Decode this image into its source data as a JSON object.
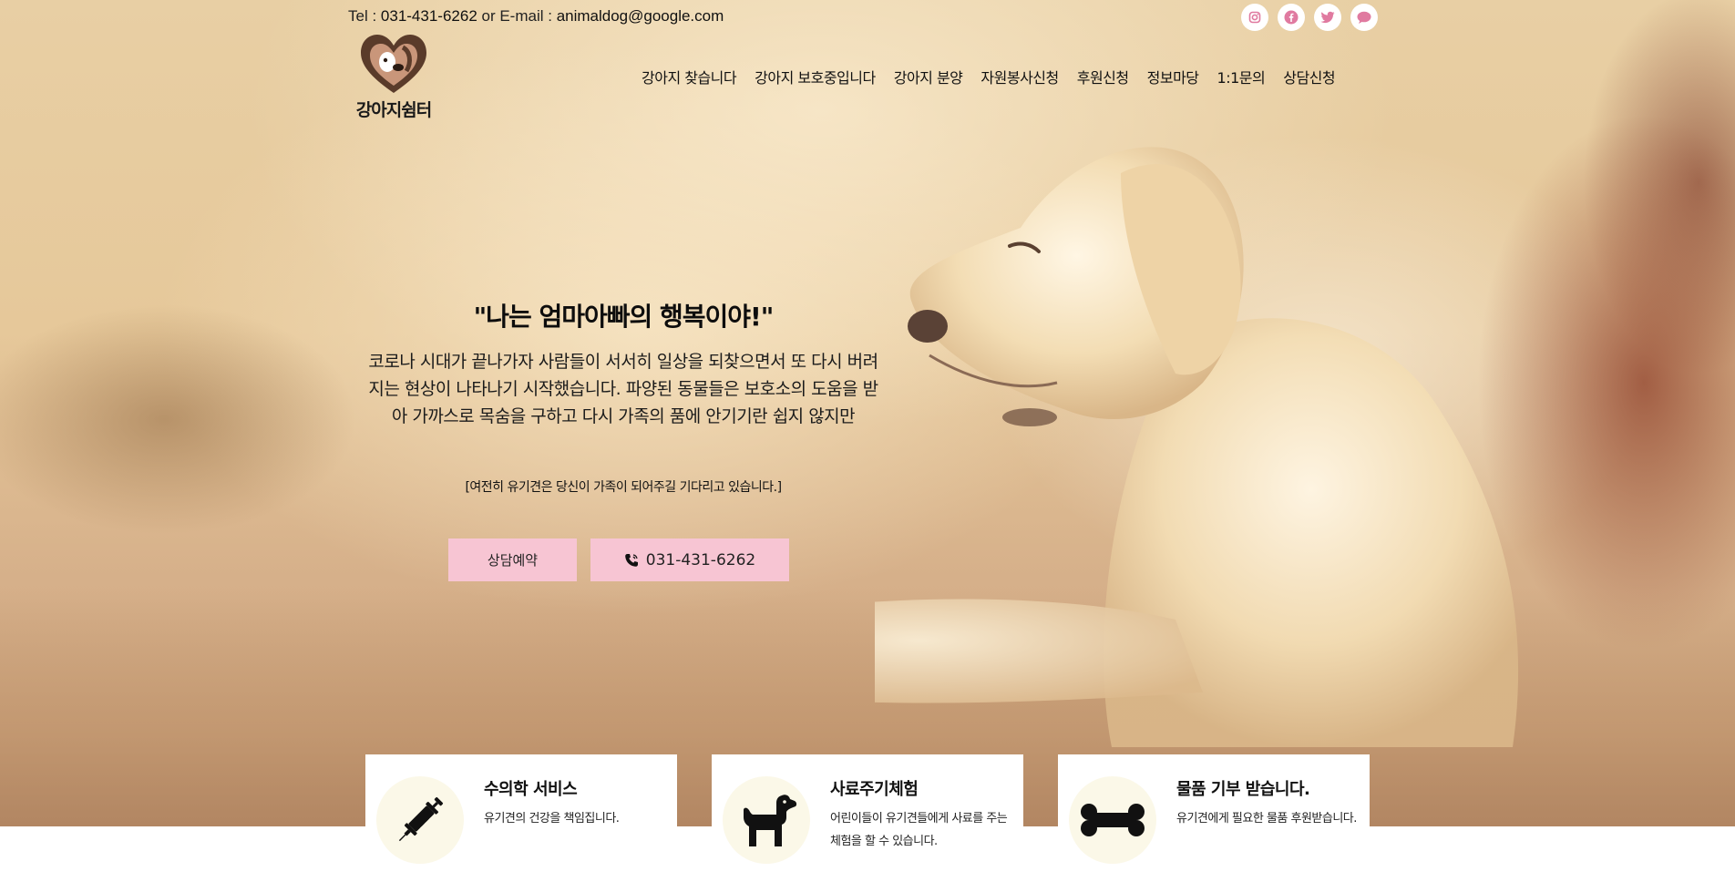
{
  "contact": {
    "tel_label": "Tel : ",
    "tel": "031-431-6262",
    "or_email_label": " or E-mail : ",
    "email": "animaldog@google.com"
  },
  "social": {
    "icons": [
      "instagram-icon",
      "facebook-icon",
      "twitter-icon",
      "chat-icon"
    ]
  },
  "logo": {
    "name": "강아지쉼터"
  },
  "nav": {
    "items": [
      "강아지 찾습니다",
      "강아지 보호중입니다",
      "강아지 분양",
      "자원봉사신청",
      "후원신청",
      "정보마당",
      "1:1문의",
      "상담신청"
    ]
  },
  "hero": {
    "headline": "\"나는 엄마아빠의 행복이야!\"",
    "description": "코로나 시대가 끝나가자 사람들이 서서히 일상을 되찾으면서 또 다시 버려지는 현상이 나타나기 시작했습니다. 파양된 동물들은 보호소의 도움을 받아 가까스로 목숨을 구하고 다시 가족의 품에 안기기란 쉽지 않지만",
    "subtext": "[여전히 유기견은 당신이 가족이 되어주길 기다리고 있습니다.]",
    "reserve_button": "상담예약",
    "phone_button": "031-431-6262"
  },
  "services": [
    {
      "icon": "syringe-icon",
      "title": "수의학 서비스",
      "text": "유기견의 건강을 책임집니다."
    },
    {
      "icon": "dog-icon",
      "title": "사료주기체험",
      "text": "어린이들이 유기견들에게 사료를 주는 체험을 할 수 있습니다."
    },
    {
      "icon": "bone-icon",
      "title": "물품 기부 받습니다.",
      "text": "유기견에게 필요한 물품 후원받습니다."
    }
  ],
  "colors": {
    "button_bg": "#f7c5d3",
    "social_icon": "#e07aa0",
    "card_circle": "#fbf8e8"
  }
}
